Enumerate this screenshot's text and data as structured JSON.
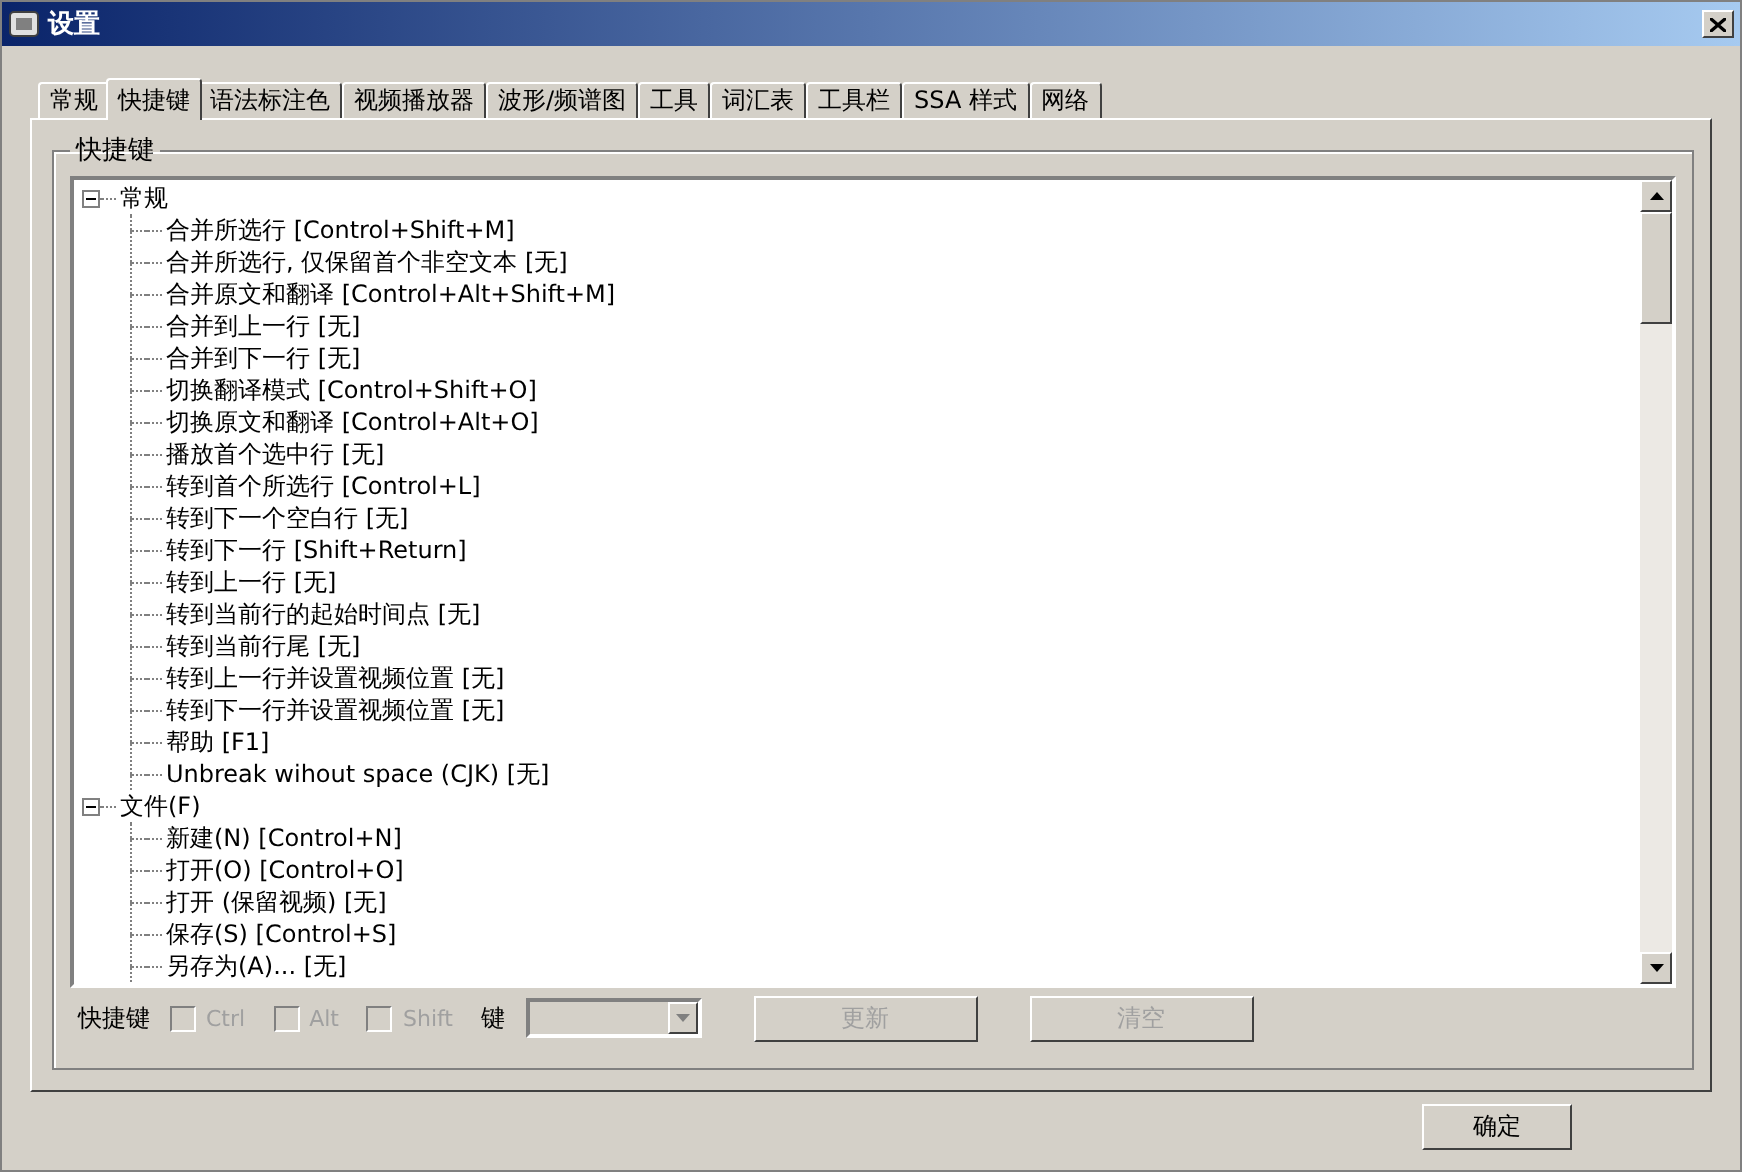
{
  "window": {
    "title": "设置"
  },
  "tabs": [
    {
      "label": "常规",
      "selected": false
    },
    {
      "label": "快捷键",
      "selected": true
    },
    {
      "label": "语法标注色",
      "selected": false
    },
    {
      "label": "视频播放器",
      "selected": false
    },
    {
      "label": "波形/频谱图",
      "selected": false
    },
    {
      "label": "工具",
      "selected": false
    },
    {
      "label": "词汇表",
      "selected": false
    },
    {
      "label": "工具栏",
      "selected": false
    },
    {
      "label": "SSA 样式",
      "selected": false
    },
    {
      "label": "网络",
      "selected": false
    }
  ],
  "group": {
    "title": "快捷键"
  },
  "tree": [
    {
      "label": "常规",
      "expanded": true,
      "children": [
        {
          "label": "合并所选行 [Control+Shift+M]"
        },
        {
          "label": "合并所选行, 仅保留首个非空文本 [无]"
        },
        {
          "label": "合并原文和翻译 [Control+Alt+Shift+M]"
        },
        {
          "label": "合并到上一行 [无]"
        },
        {
          "label": "合并到下一行 [无]"
        },
        {
          "label": "切换翻译模式 [Control+Shift+O]"
        },
        {
          "label": "切换原文和翻译 [Control+Alt+O]"
        },
        {
          "label": "播放首个选中行 [无]"
        },
        {
          "label": "转到首个所选行 [Control+L]"
        },
        {
          "label": "转到下一个空白行 [无]"
        },
        {
          "label": "转到下一行 [Shift+Return]"
        },
        {
          "label": "转到上一行 [无]"
        },
        {
          "label": "转到当前行的起始时间点 [无]"
        },
        {
          "label": "转到当前行尾 [无]"
        },
        {
          "label": "转到上一行并设置视频位置 [无]"
        },
        {
          "label": "转到下一行并设置视频位置 [无]"
        },
        {
          "label": "帮助 [F1]"
        },
        {
          "label": "Unbreak wihout space (CJK) [无]"
        }
      ]
    },
    {
      "label": "文件(F)",
      "expanded": true,
      "children": [
        {
          "label": "新建(N) [Control+N]"
        },
        {
          "label": "打开(O) [Control+O]"
        },
        {
          "label": "打开 (保留视频) [无]"
        },
        {
          "label": "保存(S) [Control+S]"
        },
        {
          "label": "另存为(A)... [无]"
        }
      ]
    }
  ],
  "editor": {
    "label": "快捷键",
    "modifiers": [
      {
        "label": "Ctrl",
        "checked": false,
        "disabled": true
      },
      {
        "label": "Alt",
        "checked": false,
        "disabled": true
      },
      {
        "label": "Shift",
        "checked": false,
        "disabled": true
      }
    ],
    "key_label": "键",
    "key_disabled": true,
    "buttons": [
      {
        "label": "更新",
        "disabled": true
      },
      {
        "label": "清空",
        "disabled": true
      }
    ]
  },
  "footer_buttons": [
    {
      "label": "确定"
    }
  ]
}
